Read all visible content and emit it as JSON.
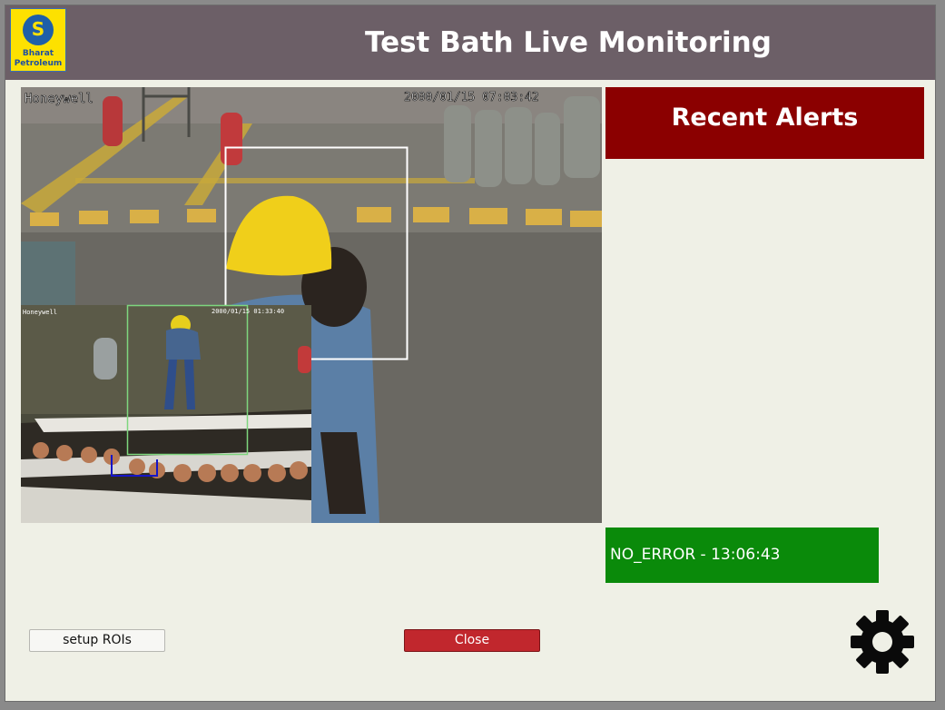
{
  "header": {
    "logo_line1": "Bharat",
    "logo_line2": "Petroleum",
    "title": "Test Bath Live Monitoring"
  },
  "feed": {
    "main_brand": "Honeywell",
    "main_timestamp": "2000/01/15 07:03:42",
    "inset_brand": "Honeywell",
    "inset_timestamp": "2000/01/15 01:33:40"
  },
  "alerts": {
    "title": "Recent Alerts",
    "status": "NO_ERROR - 13:06:43",
    "status_color": "#0a8a0a",
    "header_color": "#8b0000"
  },
  "buttons": {
    "setup_label": "setup ROIs",
    "close_label": "Close"
  },
  "icons": {
    "settings": "gear-icon"
  }
}
